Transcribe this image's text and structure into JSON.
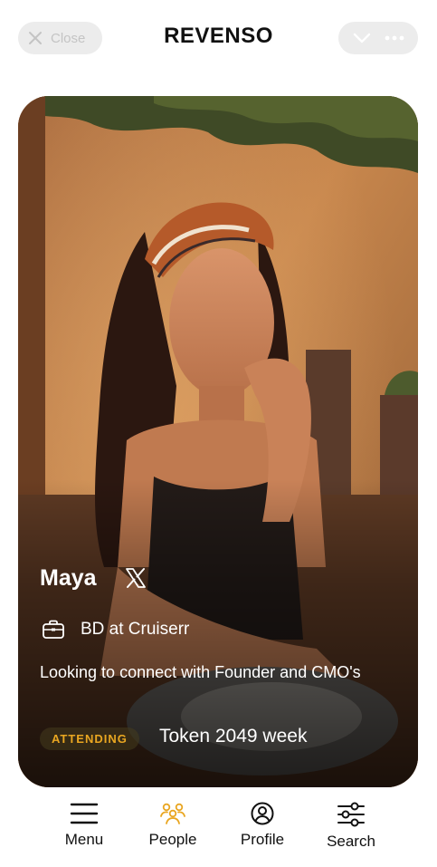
{
  "header": {
    "close_label": "Close",
    "title": "REVENSO"
  },
  "profile": {
    "name": "Maya",
    "social_icon": "x-logo-icon",
    "job": "BD at Cruiserr",
    "bio": "Looking to connect with Founder and CMO's",
    "badge": "ATTENDING",
    "event": "Token 2049 week"
  },
  "nav": {
    "items": [
      {
        "label": "Menu",
        "icon": "hamburger-menu-icon"
      },
      {
        "label": "People",
        "icon": "people-icon",
        "active": true
      },
      {
        "label": "Profile",
        "icon": "profile-icon"
      },
      {
        "label": "Search",
        "icon": "sliders-icon"
      }
    ]
  },
  "colors": {
    "accent": "#e9a621",
    "pill_bg": "#ececec",
    "text": "#111111"
  }
}
